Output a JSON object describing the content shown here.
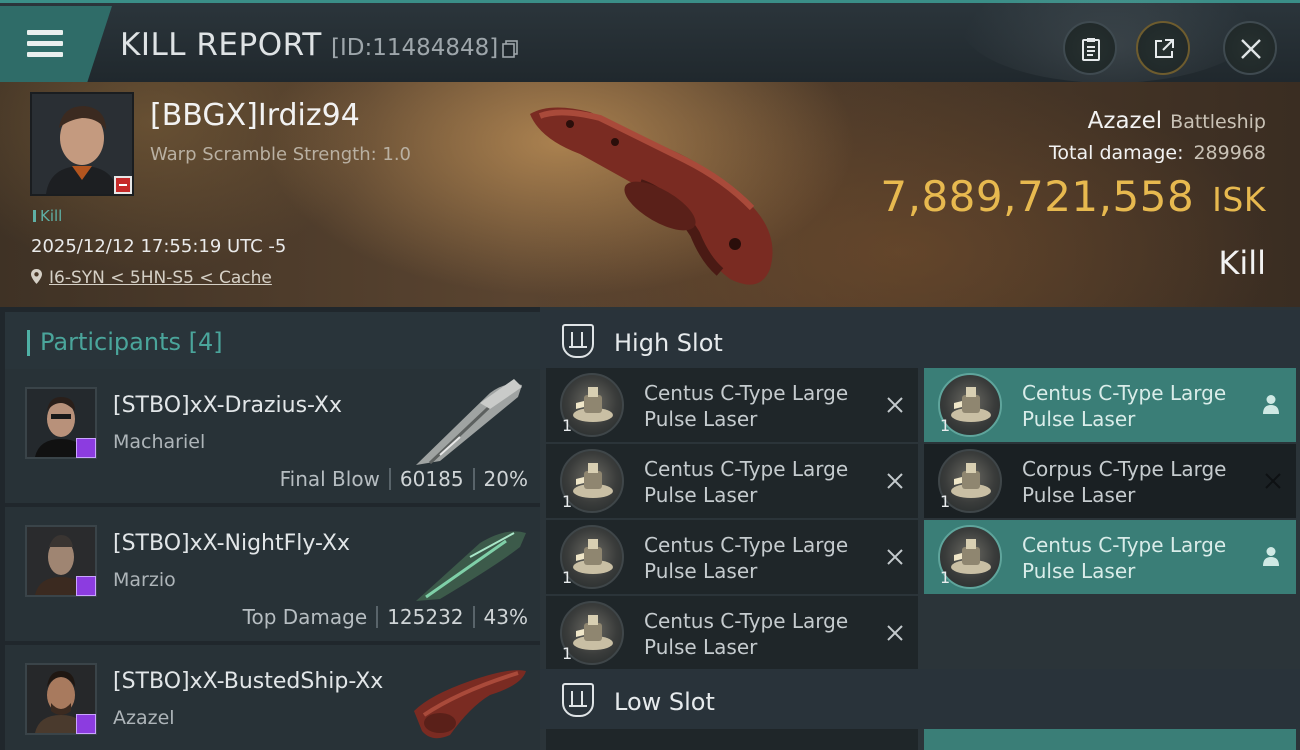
{
  "header": {
    "title": "KILL REPORT",
    "kill_id": "[ID:11484848]",
    "icons": [
      "menu-icon",
      "copy-icon",
      "clipboard-icon",
      "share-icon",
      "close-icon"
    ]
  },
  "victim": {
    "name": "[BBGX]Irdiz94",
    "warp_scramble": "Warp Scramble Strength: 1.0",
    "kill_tag": "Kill",
    "datetime": "2025/12/12 17:55:19 UTC -5",
    "location": "I6-SYN < 5HN-S5 < Cache",
    "ship_name": "Azazel",
    "ship_class": "Battleship",
    "total_damage_label": "Total damage:",
    "total_damage": "289968",
    "isk_value": "7,889,721,558",
    "isk_unit": "ISK",
    "result": "Kill"
  },
  "participants": {
    "title": "Participants",
    "count": "[4]",
    "rows": [
      {
        "name": "[STBO]xX-Drazius-Xx",
        "ship": "Machariel",
        "label": "Final Blow",
        "damage": "60185",
        "percent": "20%"
      },
      {
        "name": "[STBO]xX-NightFly-Xx",
        "ship": "Marzio",
        "label": "Top Damage",
        "damage": "125232",
        "percent": "43%"
      },
      {
        "name": "[STBO]xX-BustedShip-Xx",
        "ship": "Azazel",
        "label": "",
        "damage": "",
        "percent": ""
      }
    ]
  },
  "fitting": {
    "high_slot_title": "High Slot",
    "low_slot_title": "Low Slot",
    "modules": [
      {
        "line1": "Centus C-Type Large",
        "line2": "Pulse Laser",
        "qty": "1",
        "state": "destroyed"
      },
      {
        "line1": "Centus C-Type Large",
        "line2": "Pulse Laser",
        "qty": "1",
        "state": "dropped"
      },
      {
        "line1": "Centus C-Type Large",
        "line2": "Pulse Laser",
        "qty": "1",
        "state": "destroyed"
      },
      {
        "line1": "Corpus C-Type Large",
        "line2": "Pulse Laser",
        "qty": "1",
        "state": "destroyed"
      },
      {
        "line1": "Centus C-Type Large",
        "line2": "Pulse Laser",
        "qty": "1",
        "state": "destroyed"
      },
      {
        "line1": "Centus C-Type Large",
        "line2": "Pulse Laser",
        "qty": "1",
        "state": "dropped"
      },
      {
        "line1": "Centus C-Type Large",
        "line2": "Pulse Laser",
        "qty": "1",
        "state": "destroyed"
      }
    ]
  },
  "colors": {
    "accent": "#3a8e87",
    "isk": "#e7b94f",
    "dropped": "#3a7e77",
    "badge": "#8c3ce0",
    "minus_badge": "#c62a2a"
  }
}
